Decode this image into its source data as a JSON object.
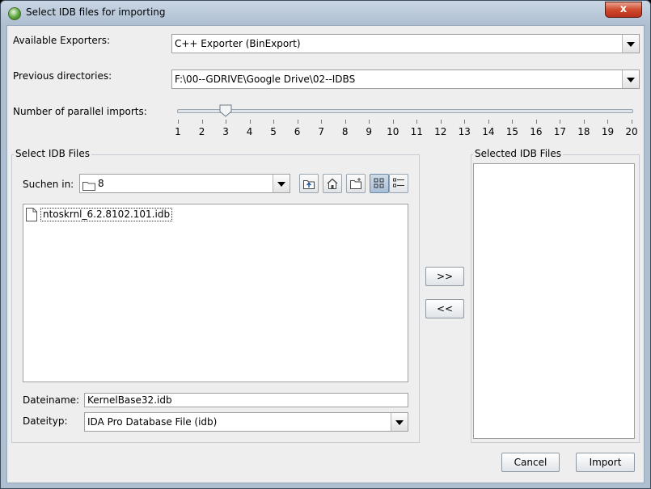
{
  "window": {
    "title": "Select IDB files for importing",
    "close_label": "x"
  },
  "icons": {
    "app": "globe-icon",
    "folder": "folder-icon",
    "file": "document-icon"
  },
  "colors": {
    "window_frame": "#aebfd2",
    "panel": "#eeeeee",
    "close_button": "#c9402a"
  },
  "exporters": {
    "label": "Available Exporters:",
    "value": "C++ Exporter (BinExport)"
  },
  "previous_dirs": {
    "label": "Previous directories:",
    "value": "F:\\00--GDRIVE\\Google Drive\\02--IDBS"
  },
  "parallel": {
    "label": "Number of parallel imports:",
    "value": 3,
    "min": 1,
    "max": 20,
    "ticks": [
      "1",
      "2",
      "3",
      "4",
      "5",
      "6",
      "7",
      "8",
      "9",
      "10",
      "11",
      "12",
      "13",
      "14",
      "15",
      "16",
      "17",
      "18",
      "19",
      "20"
    ]
  },
  "file_chooser": {
    "group_title": "Select IDB Files",
    "look_in_label": "Suchen in:",
    "look_in_value": "8",
    "toolbar": [
      "up-folder-icon",
      "home-icon",
      "new-folder-icon",
      "list-view-icon",
      "details-view-icon"
    ],
    "files": [
      "ntoskrnl_6.2.8102.101.idb"
    ],
    "filename_label": "Dateiname:",
    "filename_value": "KernelBase32.idb",
    "filetype_label": "Dateityp:",
    "filetype_value": "IDA Pro Database File (idb)"
  },
  "transfer": {
    "add_label": ">>",
    "remove_label": "<<"
  },
  "selected": {
    "group_title": "Selected IDB Files",
    "items": []
  },
  "buttons": {
    "cancel": "Cancel",
    "import": "Import"
  }
}
